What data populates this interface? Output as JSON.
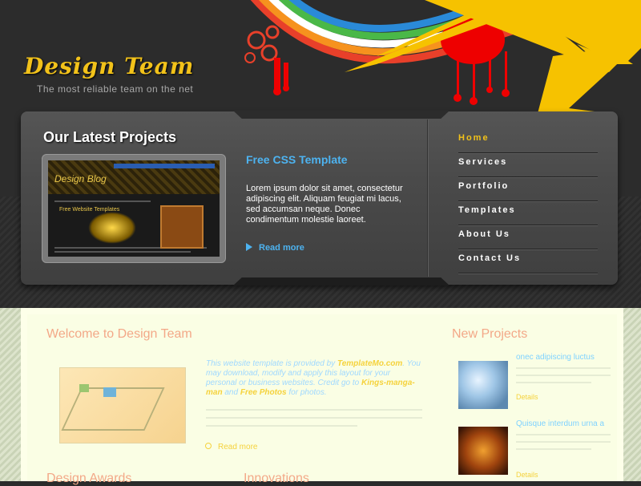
{
  "header": {
    "logo": "Design Team",
    "tagline": "The most reliable team on the net"
  },
  "featured": {
    "title": "Our Latest Projects",
    "project_title": "Free CSS Template",
    "project_text": "Lorem ipsum dolor sit amet, consectetur adipiscing elit. Aliquam feugiat mi lacus, sed accumsan neque. Donec condimentum molestie laoreet.",
    "read_more": "Read more",
    "screenshot_title": "Design Blog",
    "screenshot_subtitle": "Free Website Templates"
  },
  "nav": {
    "items": [
      "Home",
      "Services",
      "Portfolio",
      "Templates",
      "About Us",
      "Contact Us"
    ],
    "active": "Home"
  },
  "welcome": {
    "title": "Welcome to Design Team",
    "text_part1": "This website template is provided by ",
    "link1": "TemplateMo.com",
    "text_part2": ". You may download, modify and apply this layout for your personal or business websites. Credit go to ",
    "link2": "Kings-manga-man",
    "text_part3": " and ",
    "link3": "Free Photos",
    "text_part4": " for photos.",
    "read_more": "Read more"
  },
  "new_projects": {
    "title": "New Projects",
    "items": [
      {
        "title": "onec adipiscing luctus",
        "details": "Details"
      },
      {
        "title": "Quisque interdum urna a",
        "details": "Details"
      }
    ]
  },
  "bottom": {
    "awards_title": "Design Awards",
    "innovations_title": "Innovations"
  },
  "colors": {
    "accent_yellow": "#f2c21a",
    "link_blue": "#4db3f0",
    "section_title": "#f3a888",
    "content_bg": "#fafee4"
  }
}
